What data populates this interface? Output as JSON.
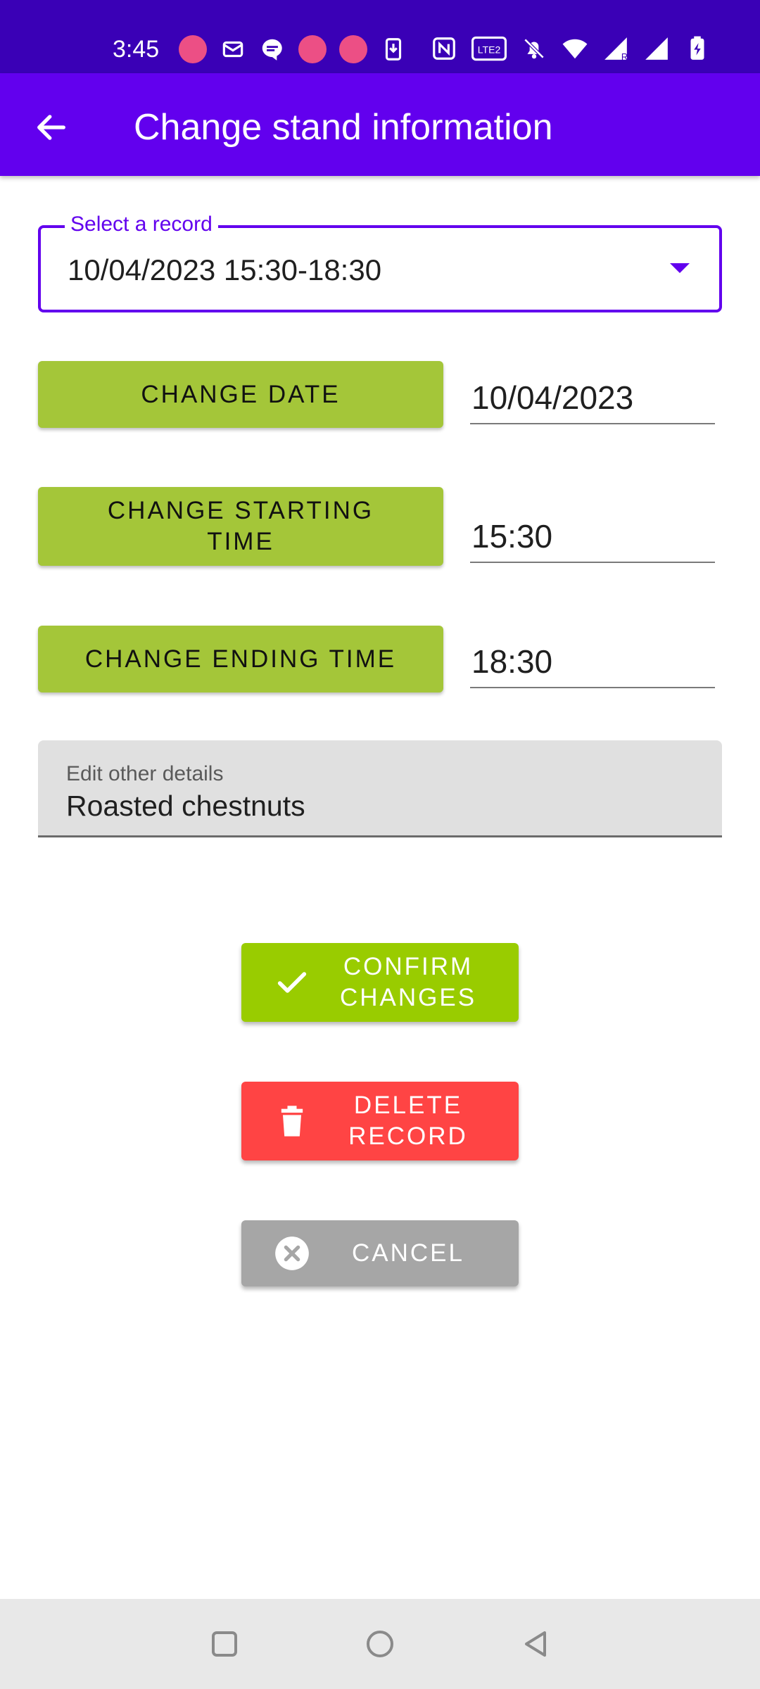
{
  "status_bar": {
    "time": "3:45",
    "left_icons": [
      "app-notification-icon",
      "mail-icon",
      "message-icon",
      "app-notification-icon",
      "app-notification-icon",
      "download-icon"
    ],
    "right_icons": [
      "nfc-icon",
      "volte-icon",
      "bell-off-icon",
      "wifi-icon",
      "signal-icon",
      "signal-icon",
      "battery-charging-icon"
    ],
    "volte_label": "Vo LTE2"
  },
  "app_bar": {
    "title": "Change stand information",
    "back_icon": "arrow-left-icon"
  },
  "record_select": {
    "label": "Select a record",
    "value": "10/04/2023 15:30-18:30"
  },
  "date_row": {
    "button_label": "CHANGE DATE",
    "value": "10/04/2023"
  },
  "start_row": {
    "button_label": "CHANGE STARTING TIME",
    "value": "15:30"
  },
  "end_row": {
    "button_label": "CHANGE ENDING TIME",
    "value": "18:30"
  },
  "details_field": {
    "label": "Edit other details",
    "value": "Roasted chestnuts"
  },
  "actions": {
    "confirm_label": "CONFIRM CHANGES",
    "delete_label": "DELETE RECORD",
    "cancel_label": "CANCEL"
  },
  "colors": {
    "status_bar": "#3a00b6",
    "app_bar": "#6200ee",
    "olive_button": "#a4c639",
    "confirm": "#99cc00",
    "delete": "#ff4444",
    "cancel": "#a6a6a6"
  },
  "nav_bar": {
    "items": [
      "recents-icon",
      "home-icon",
      "back-icon"
    ]
  }
}
